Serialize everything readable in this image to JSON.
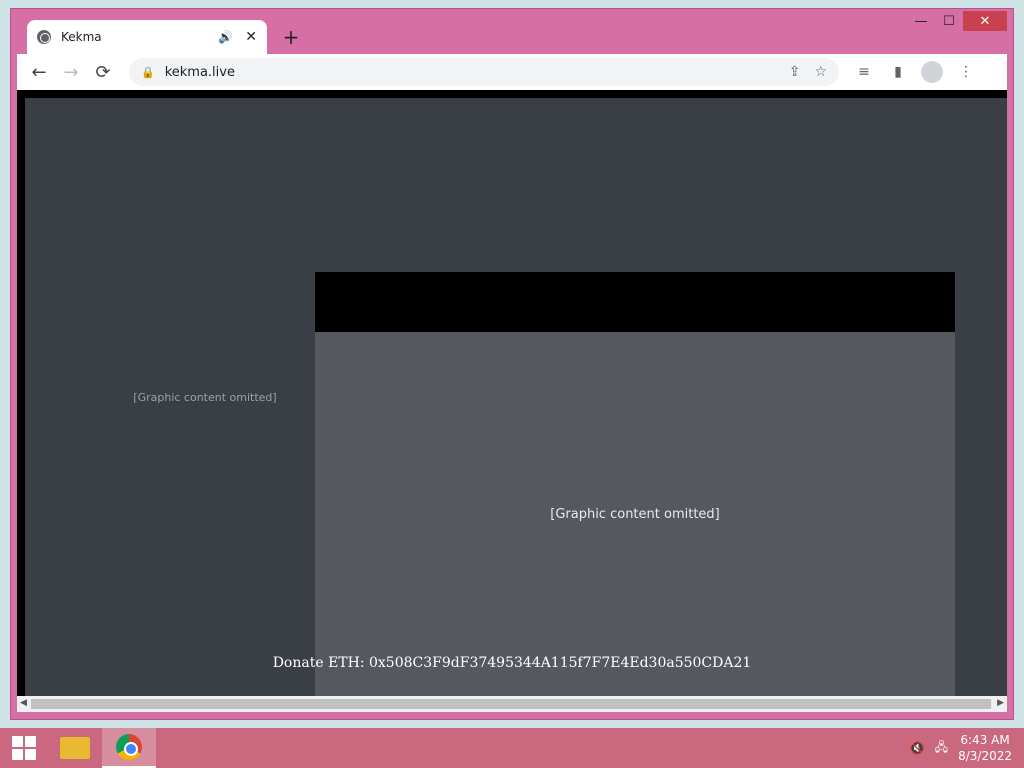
{
  "window": {
    "controls": [
      "—",
      "☐",
      "✕"
    ]
  },
  "tab": {
    "title": "Kekma",
    "sound": "🔊",
    "close": "✕"
  },
  "newtab": "+",
  "toolbar": {
    "back": "←",
    "forward": "→",
    "reload": "⟳",
    "lock": "🔒",
    "url": "kekma.live",
    "share": "⇪",
    "star": "☆",
    "media": "≡",
    "sidepanel": "▮",
    "menu": "⋮"
  },
  "page": {
    "placeholder_note": "[Graphic content omitted]",
    "donate_text": "Donate ETH: 0x508C3F9dF37495344A115f7F7E4Ed30a550CDA21"
  },
  "taskbar": {
    "time": "6:43 AM",
    "date": "8/3/2022",
    "volume": "🔇",
    "network": "🖧"
  }
}
